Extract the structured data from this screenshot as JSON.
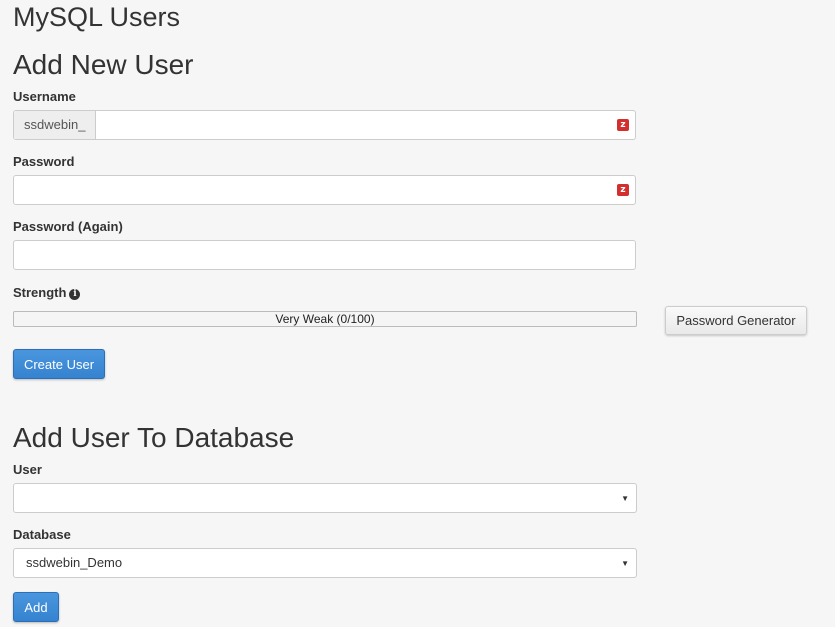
{
  "page": {
    "title": "MySQL Users"
  },
  "add_new_user": {
    "heading": "Add New User",
    "username_label": "Username",
    "username_prefix": "ssdwebin_",
    "username_value": "",
    "password_label": "Password",
    "password_value": "",
    "password_again_label": "Password (Again)",
    "password_again_value": "",
    "strength_label": "Strength",
    "strength_text": "Very Weak (0/100)",
    "strength_score": 0,
    "password_generator_label": "Password Generator",
    "create_user_label": "Create User",
    "lastpass_icon_glyph": "z",
    "info_icon_glyph": "i"
  },
  "add_user_to_database": {
    "heading": "Add User To Database",
    "user_label": "User",
    "user_selected": "",
    "database_label": "Database",
    "database_selected": "ssdwebin_Demo",
    "add_label": "Add",
    "caret_glyph": "▼"
  },
  "colors": {
    "primary": "#3a87d4",
    "strength_weak": "#d9534f",
    "background": "#f6f6f6"
  }
}
